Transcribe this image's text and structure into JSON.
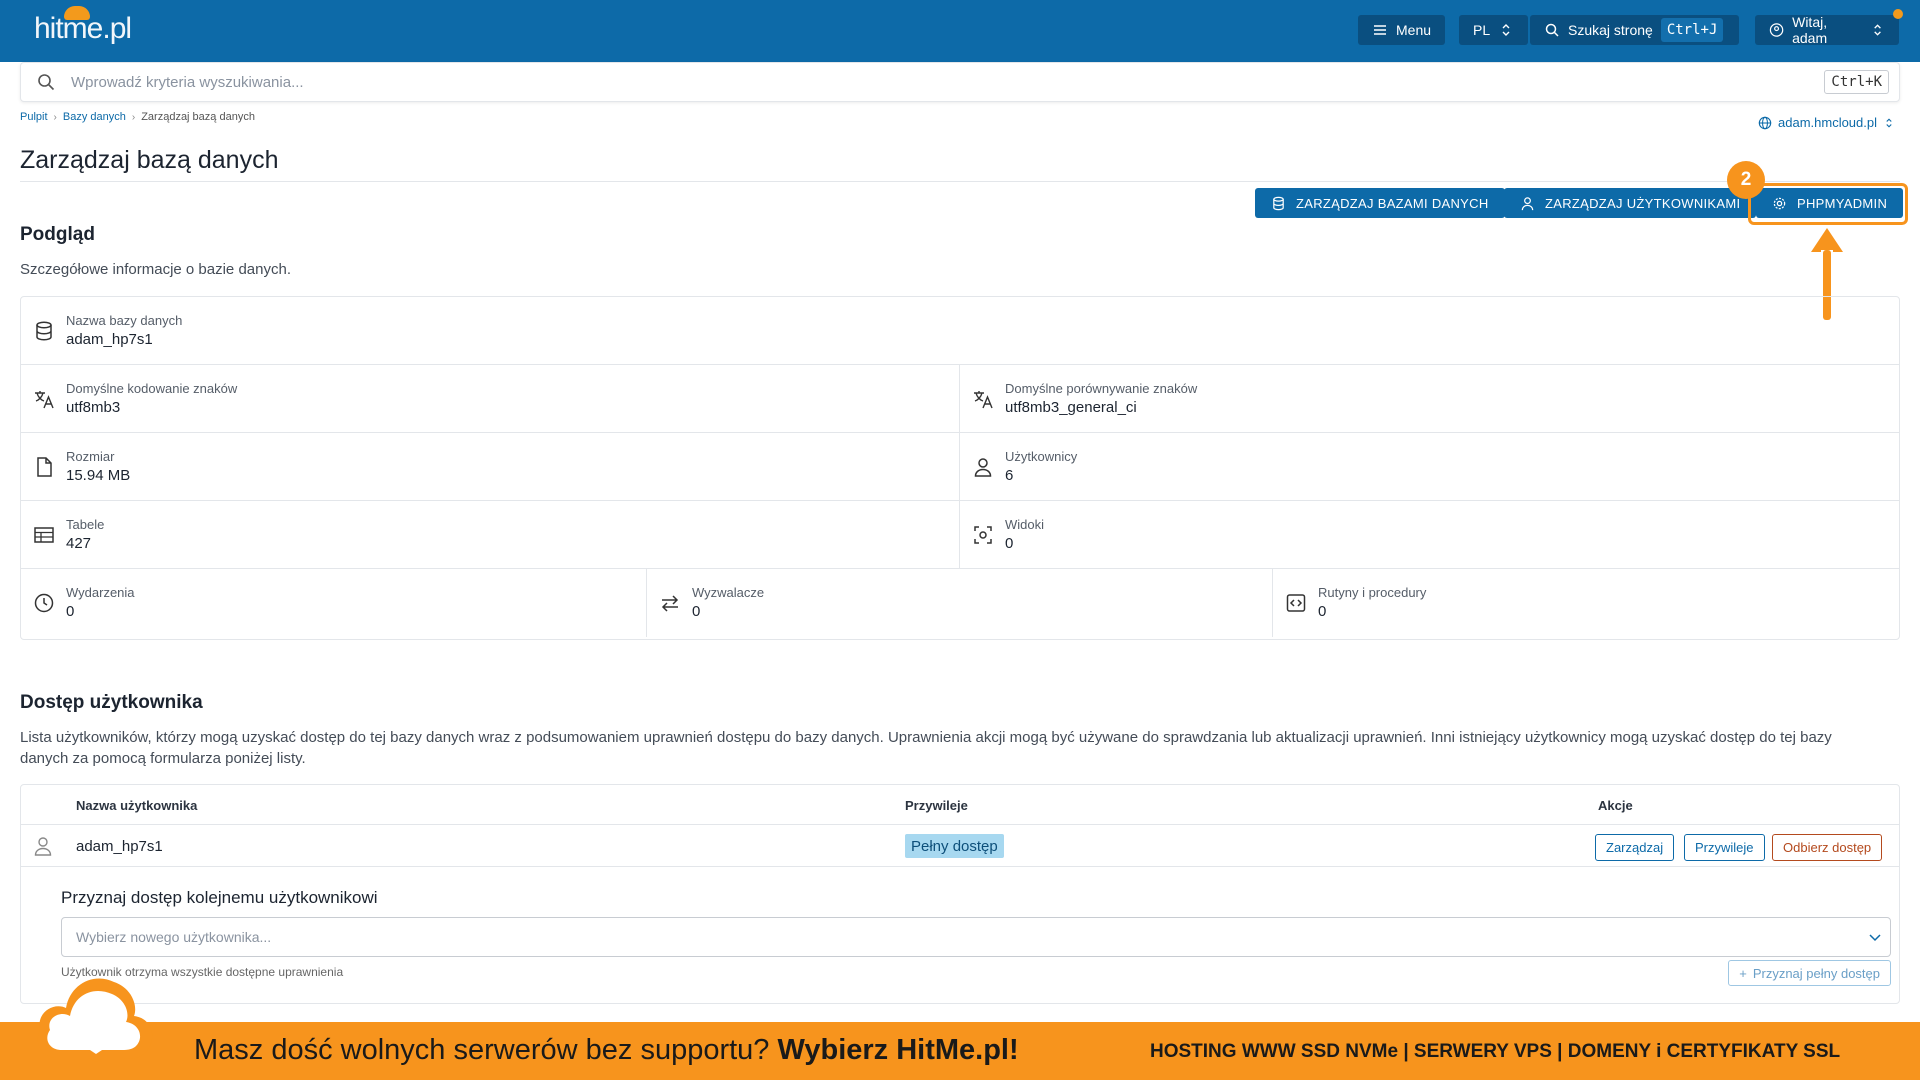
{
  "app": {
    "logo_main": "hitme",
    "logo_suffix": ".pl"
  },
  "topbar": {
    "menu_label": "Menu",
    "lang_label": "PL",
    "search_label": "Szukaj stronę",
    "search_shortcut": "Ctrl+J",
    "user_label": "Witaj, adam"
  },
  "search": {
    "placeholder": "Wprowadź kryteria wyszukiwania...",
    "shortcut": "Ctrl+K"
  },
  "breadcrumb": {
    "items": [
      "Pulpit",
      "Bazy danych",
      "Zarządzaj bazą danych"
    ]
  },
  "domain_selector": "adam.hmcloud.pl",
  "page_title": "Zarządzaj bazą danych",
  "actions": {
    "manage_databases": "ZARZĄDZAJ BAZAMI DANYCH",
    "manage_users": "ZARZĄDZAJ UŻYTKOWNIKAMI",
    "phpmyadmin": "PHPMYADMIN"
  },
  "highlight": {
    "step_number": "2",
    "accent_color": "#f7941d"
  },
  "overview": {
    "title": "Podgląd",
    "description": "Szczegółowe informacje o bazie danych.",
    "fields": {
      "db_name": {
        "label": "Nazwa bazy danych",
        "value": "adam_hp7s1",
        "icon": "database-icon"
      },
      "charset": {
        "label": "Domyślne kodowanie znaków",
        "value": "utf8mb3",
        "icon": "translate-icon"
      },
      "collation": {
        "label": "Domyślne porównywanie znaków",
        "value": "utf8mb3_general_ci",
        "icon": "translate-icon"
      },
      "size": {
        "label": "Rozmiar",
        "value": "15.94 MB",
        "icon": "file-icon"
      },
      "users": {
        "label": "Użytkownicy",
        "value": "6",
        "icon": "user-icon"
      },
      "tables": {
        "label": "Tabele",
        "value": "427",
        "icon": "table-icon"
      },
      "views": {
        "label": "Widoki",
        "value": "0",
        "icon": "view-icon"
      },
      "events": {
        "label": "Wydarzenia",
        "value": "0",
        "icon": "clock-icon"
      },
      "triggers": {
        "label": "Wyzwalacze",
        "value": "0",
        "icon": "swap-icon"
      },
      "routines": {
        "label": "Rutyny i procedury",
        "value": "0",
        "icon": "code-icon"
      }
    }
  },
  "user_access": {
    "title": "Dostęp użytkownika",
    "description": "Lista użytkowników, którzy mogą uzyskać dostęp do tej bazy danych wraz z podsumowaniem uprawnień dostępu do bazy danych. Uprawnienia akcji mogą być używane do sprawdzania lub aktualizacji uprawnień. Inni istniejący użytkownicy mogą uzyskać dostęp do tej bazy danych za pomocą formularza poniżej listy.",
    "columns": {
      "username": "Nazwa użytkownika",
      "privileges": "Przywileje",
      "actions": "Akcje"
    },
    "rows": [
      {
        "username": "adam_hp7s1",
        "privileges": "Pełny dostęp",
        "btn_manage": "Zarządzaj",
        "btn_privileges": "Przywileje",
        "btn_revoke": "Odbierz dostęp"
      }
    ],
    "grant": {
      "title": "Przyznaj dostęp kolejnemu użytkownikowi",
      "placeholder": "Wybierz nowego użytkownika...",
      "note": "Użytkownik otrzyma wszystkie dostępne uprawnienia",
      "button": "Przyznaj pełny dostęp"
    }
  },
  "banner": {
    "text_regular": "Masz dość wolnych serwerów bez supportu?",
    "text_bold": "Wybierz HitMe.pl!",
    "right_text": "HOSTING WWW SSD NVMe | SERWERY VPS | DOMENY i CERTYFIKATY SSL"
  },
  "colors": {
    "primary": "#0d6aa8",
    "topbar": "#0d6aa8",
    "orange": "#f7941d",
    "badge_full_access": "#a7d8f0"
  }
}
